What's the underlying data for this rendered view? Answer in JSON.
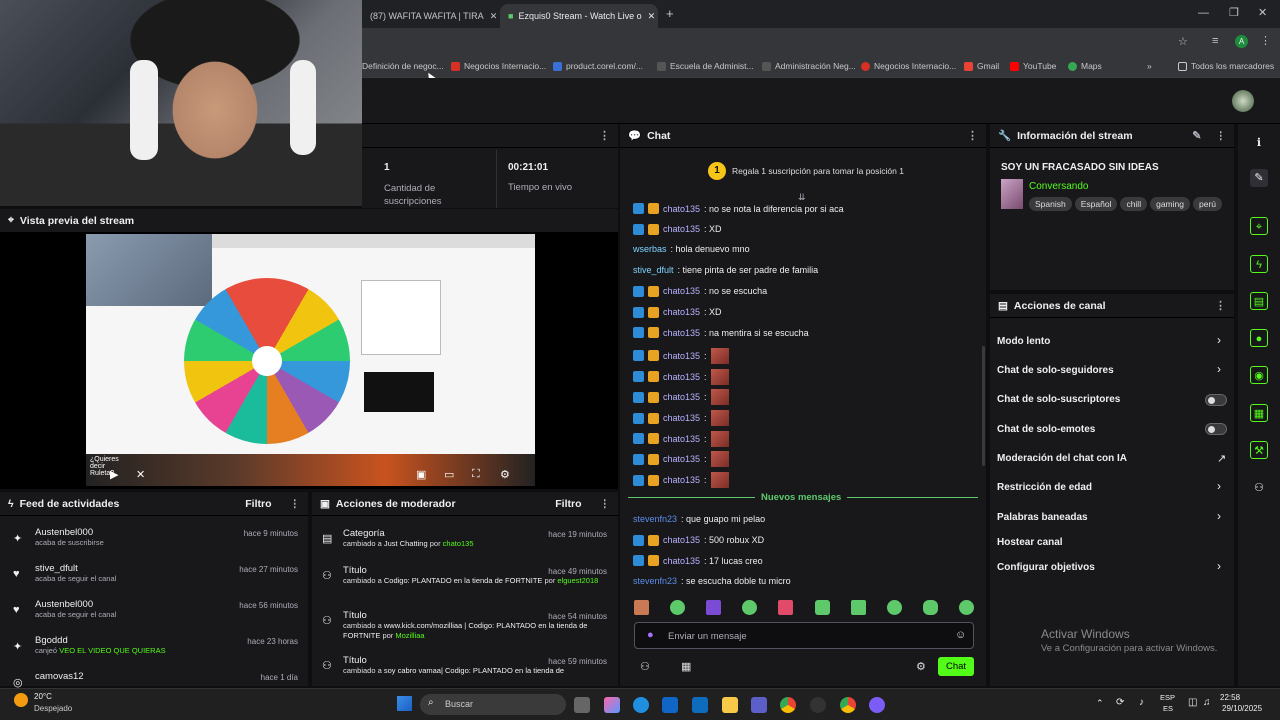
{
  "browser": {
    "tabs": [
      {
        "label": "(87) WAFITA WAFITA | TIRA"
      },
      {
        "label": "Ezquis0 Stream - Watch Live o"
      }
    ],
    "bookmarks": [
      "Definición de negoc...",
      "Negocios Internacio...",
      "product.corel.com/...",
      "Escuela de Administ...",
      "Administración Neg...",
      "Negocios Internacio...",
      "Gmail",
      "YouTube",
      "Maps"
    ],
    "bookmarks_folder": "Todos los marcadores",
    "new_tab": "+"
  },
  "stats": {
    "subs_value": "1",
    "subs_label": "Cantidad de suscripciones",
    "time_value": "00:21:01",
    "time_label": "Tiempo en vivo"
  },
  "preview": {
    "title": "Vista previa del stream",
    "overlay_text": "¿Quieres decir Ruleta?"
  },
  "chat": {
    "title": "Chat",
    "hype": "Regala 1 suscripción para tomar la posición 1",
    "hype_rank": "1",
    "messages": [
      {
        "user": "chato135",
        "text": ": no se nota la diferencia por si aca"
      },
      {
        "user": "chato135",
        "text": ": XD"
      },
      {
        "user": "wserbas",
        "text": ": hola denuevo mno"
      },
      {
        "user": "stive_dfult",
        "text": ": tiene pinta de ser padre de familia"
      },
      {
        "user": "chato135",
        "text": ": no se escucha"
      },
      {
        "user": "chato135",
        "text": ": XD"
      },
      {
        "user": "chato135",
        "text": ": na mentira si se escucha"
      },
      {
        "user": "chato135",
        "text": ":"
      },
      {
        "user": "chato135",
        "text": ":"
      },
      {
        "user": "chato135",
        "text": ":"
      },
      {
        "user": "chato135",
        "text": ":"
      },
      {
        "user": "chato135",
        "text": ":"
      },
      {
        "user": "chato135",
        "text": ":"
      },
      {
        "user": "chato135",
        "text": ":"
      }
    ],
    "new_messages": "Nuevos mensajes",
    "new": [
      {
        "user": "stevenfn23",
        "text": ": que guapo mi pelao"
      },
      {
        "user": "chato135",
        "text": ": 500 robux XD"
      },
      {
        "user": "chato135",
        "text": ": 17 lucas creo"
      },
      {
        "user": "stevenfn23",
        "text": ": se escucha doble tu micro"
      }
    ],
    "input_placeholder": "Enviar un mensaje",
    "send": "Chat"
  },
  "info": {
    "title": "Información del stream",
    "stream_title": "SOY UN FRACASADO SIN IDEAS",
    "category": "Conversando",
    "tags": [
      "Spanish",
      "Español",
      "chill",
      "gaming",
      "perú"
    ]
  },
  "actions": {
    "title": "Acciones de canal",
    "items": [
      "Modo lento",
      "Chat de solo-seguidores",
      "Chat de solo-suscriptores",
      "Chat de solo-emotes",
      "Moderación del chat con IA",
      "Restricción de edad",
      "Palabras baneadas",
      "Hostear canal",
      "Configurar objetivos"
    ]
  },
  "feed": {
    "title": "Feed de actividades",
    "filter": "Filtro",
    "items": [
      {
        "user": "Austenbel000",
        "sub": "acaba de suscribirse",
        "time": "hace 9 minutos"
      },
      {
        "user": "stive_dfult",
        "sub": "acaba de seguir el canal",
        "time": "hace 27 minutos"
      },
      {
        "user": "Austenbel000",
        "sub": "acaba de seguir el canal",
        "time": "hace 56 minutos"
      },
      {
        "user": "Bgoddd",
        "sub": "canjeó ",
        "highlight": "VEO EL VIDEO QUE QUIERAS",
        "time": "hace 23 horas"
      },
      {
        "user": "camovas12",
        "sub": "",
        "time": "hace 1 día"
      }
    ]
  },
  "mod": {
    "title": "Acciones de moderador",
    "filter": "Filtro",
    "items": [
      {
        "head": "Categoría",
        "pre": "cambiado a ",
        "hl": "Just Chatting",
        "mid": " por ",
        "by": "chato135",
        "time": "hace 19 minutos"
      },
      {
        "head": "Título",
        "pre": "cambiado a ",
        "hl": "Codigo: PLANTADO en la tienda de FORTNITE",
        "mid": " por ",
        "by": "elguest2018",
        "time": "hace 49 minutos"
      },
      {
        "head": "Título",
        "pre": "cambiado a ",
        "hl": "www.kick.com/mozilliaa | Codigo: PLANTADO en la tienda de FORTNITE",
        "mid": " por ",
        "by": "Mozilliaa",
        "time": "hace 54 minutos"
      },
      {
        "head": "Título",
        "pre": "cambiado a ",
        "hl": "soy cabro vamaa| Codigo: PLANTADO en la tienda de",
        "mid": "",
        "by": "",
        "time": "hace 59 minutos"
      }
    ]
  },
  "watermark": {
    "line1": "Activar Windows",
    "line2": "Ve a Configuración para activar Windows."
  },
  "taskbar": {
    "temp": "20°C",
    "weather": "Despejado",
    "search": "Buscar",
    "lang1": "ESP",
    "lang2": "ES",
    "time": "22:58",
    "date": "29/10/2025"
  }
}
